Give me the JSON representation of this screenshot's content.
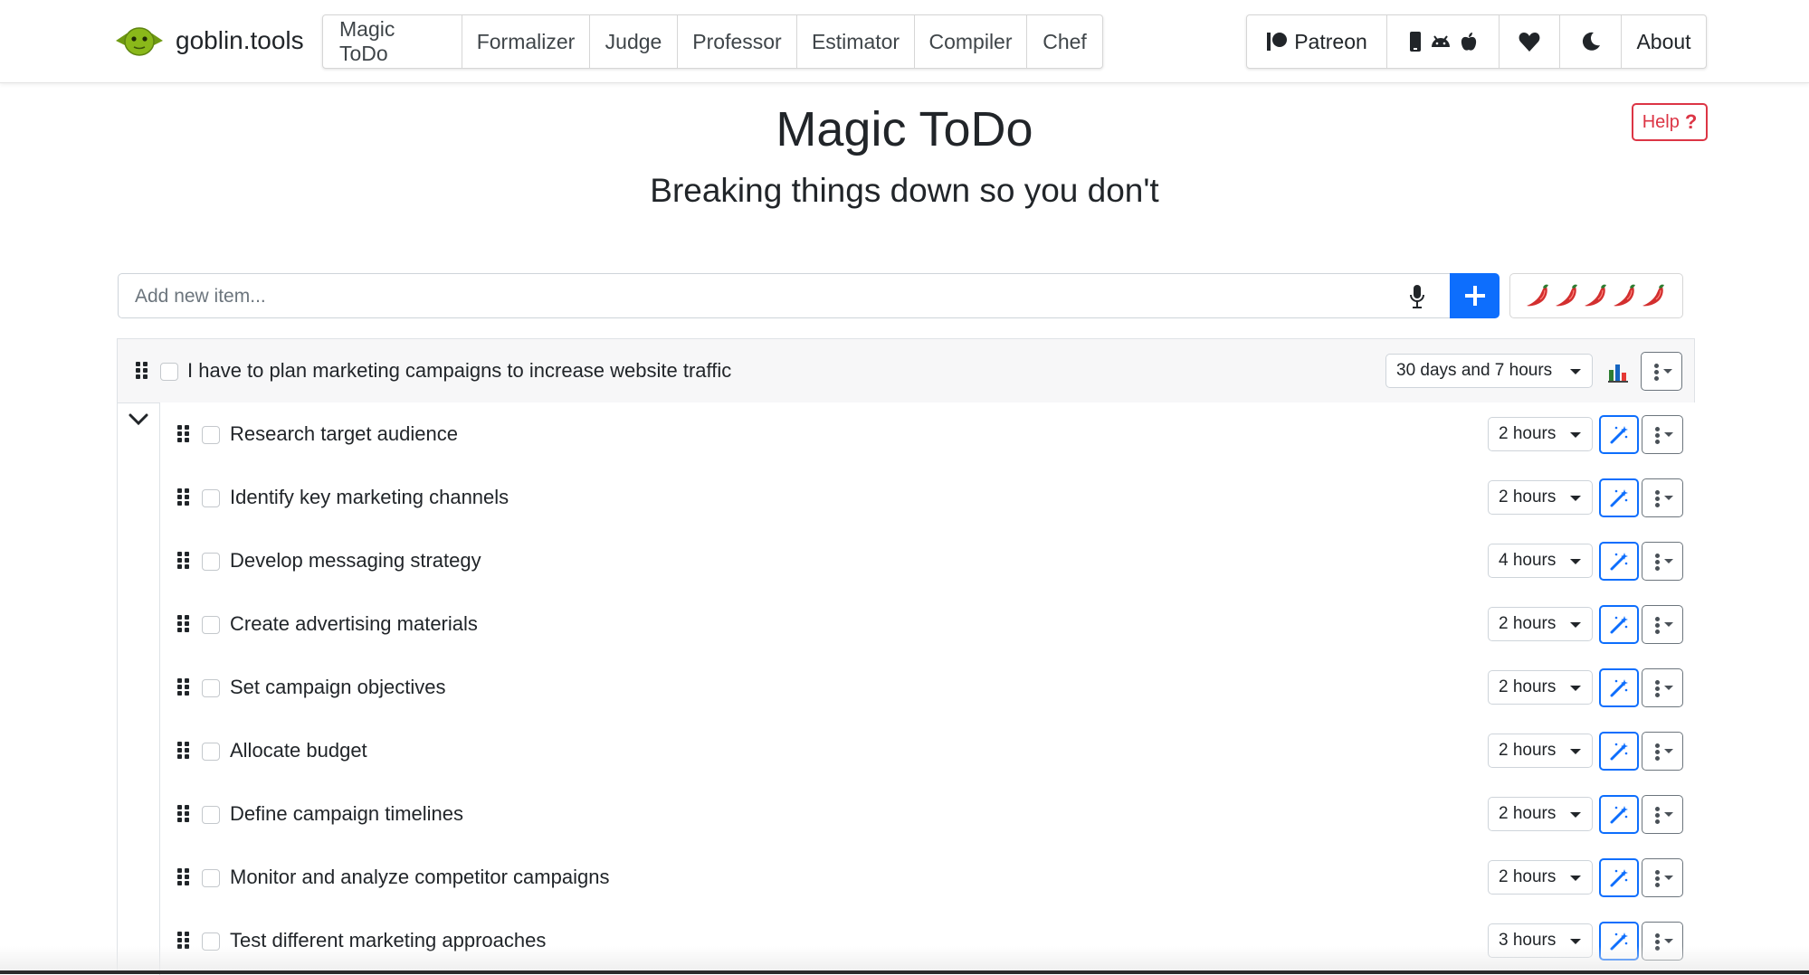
{
  "brand": {
    "name": "goblin.tools",
    "logo_icon": "goblin-head-icon",
    "logo_color": "#8ab81a"
  },
  "nav": {
    "tools": [
      "Magic ToDo",
      "Formalizer",
      "Judge",
      "Professor",
      "Estimator",
      "Compiler",
      "Chef"
    ],
    "patreon_label": "Patreon",
    "about_label": "About",
    "icons": [
      "patreon-icon",
      "mobile-phone-icon",
      "android-icon",
      "apple-icon",
      "heart-icon",
      "moon-icon"
    ]
  },
  "header": {
    "title": "Magic ToDo",
    "subtitle": "Breaking things down so you don't",
    "help_label": "Help",
    "help_icon": "question-mark-icon"
  },
  "input": {
    "placeholder": "Add new item...",
    "mic_icon": "microphone-icon",
    "add_icon": "plus-icon",
    "spice_icon": "chili-pepper-icon",
    "spice_level": 5,
    "accent_color": "#0d6efd"
  },
  "tasks": {
    "parent": {
      "text": "I have to plan marketing campaigns to increase website traffic",
      "estimate": "30 days and 7 hours",
      "stats_icon": "bar-chart-icon"
    },
    "subtasks": [
      {
        "text": "Research target audience",
        "estimate": "2 hours"
      },
      {
        "text": "Identify key marketing channels",
        "estimate": "2 hours"
      },
      {
        "text": "Develop messaging strategy",
        "estimate": "4 hours"
      },
      {
        "text": "Create advertising materials",
        "estimate": "2 hours"
      },
      {
        "text": "Set campaign objectives",
        "estimate": "2 hours"
      },
      {
        "text": "Allocate budget",
        "estimate": "2 hours"
      },
      {
        "text": "Define campaign timelines",
        "estimate": "2 hours"
      },
      {
        "text": "Monitor and analyze competitor campaigns",
        "estimate": "2 hours"
      },
      {
        "text": "Test different marketing approaches",
        "estimate": "3 hours"
      }
    ]
  }
}
